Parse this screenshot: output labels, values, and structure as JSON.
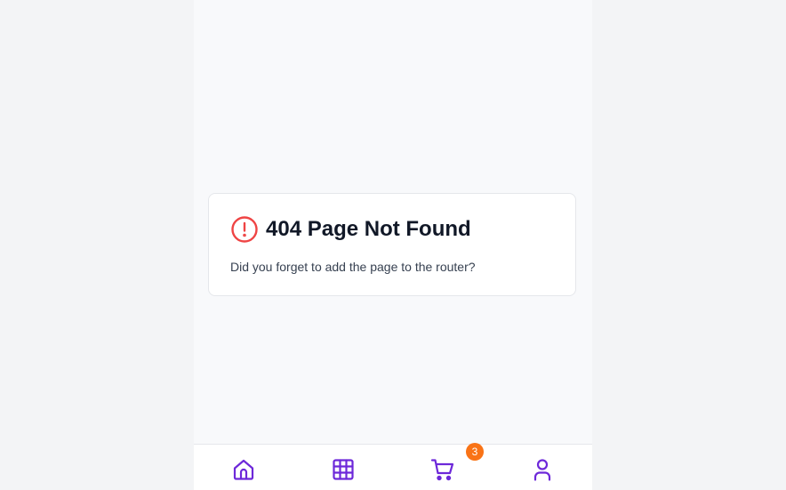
{
  "error": {
    "title": "404 Page Not Found",
    "message": "Did you forget to add the page to the router?",
    "icon": "alert-circle-icon",
    "icon_color": "#ef4444"
  },
  "bottom_nav": {
    "accent_color": "#6d28d9",
    "items": [
      {
        "icon": "home-icon"
      },
      {
        "icon": "grid-icon"
      },
      {
        "icon": "cart-icon",
        "badge": "3",
        "badge_color": "#f97316"
      },
      {
        "icon": "user-icon"
      }
    ]
  }
}
